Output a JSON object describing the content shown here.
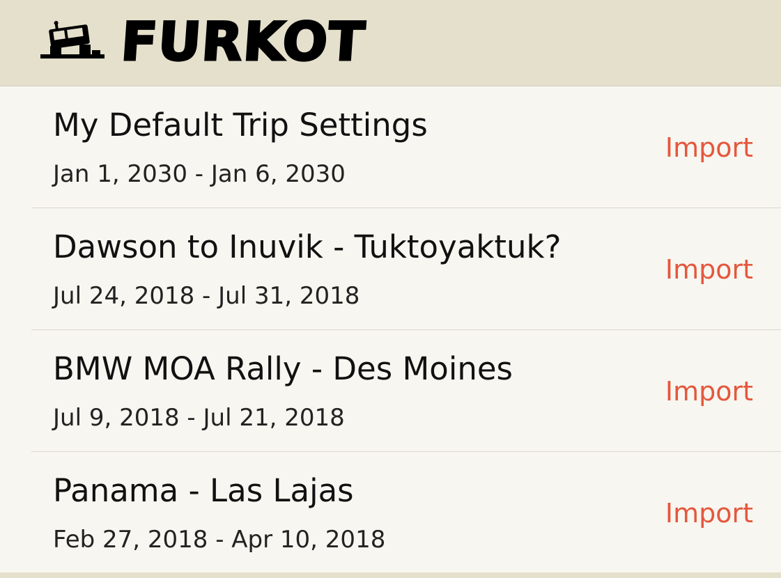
{
  "header": {
    "app_name": "FURKOT",
    "logo_icon": "vehicle-on-ramp-icon"
  },
  "trips": [
    {
      "title": "My Default Trip Settings",
      "dates": "Jan 1, 2030 - Jan 6, 2030",
      "action_label": "Import"
    },
    {
      "title": "Dawson to Inuvik - Tuktoyaktuk?",
      "dates": "Jul 24, 2018 - Jul 31, 2018",
      "action_label": "Import"
    },
    {
      "title": "BMW MOA Rally - Des Moines",
      "dates": "Jul 9, 2018 - Jul 21, 2018",
      "action_label": "Import"
    },
    {
      "title": "Panama - Las Lajas",
      "dates": "Feb 27, 2018 - Apr 10, 2018",
      "action_label": "Import"
    }
  ],
  "colors": {
    "header_bg": "#e5e0cc",
    "list_bg": "#f7f6f0",
    "accent": "#e4573d"
  }
}
